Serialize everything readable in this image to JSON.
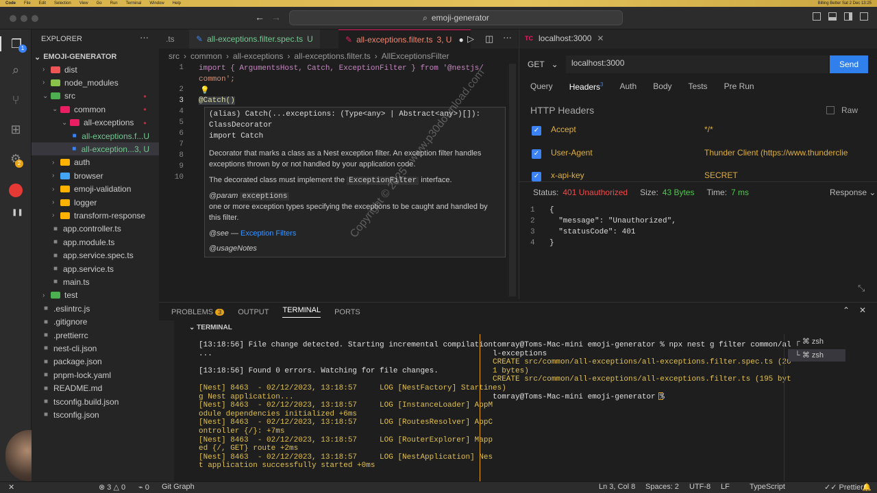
{
  "macbar": {
    "app": "Code",
    "menus": [
      "File",
      "Edit",
      "Selection",
      "View",
      "Go",
      "Run",
      "Terminal",
      "Window",
      "Help"
    ],
    "right": "Billing Better   Sat 2 Dec 13:25"
  },
  "window": {
    "search": "emoji-generator"
  },
  "sidebar": {
    "title": "EXPLORER",
    "project": "EMOJI-GENERATOR",
    "items": [
      {
        "label": "dist",
        "color": "#e55"
      },
      {
        "label": "node_modules",
        "color": "#8bc34a"
      },
      {
        "label": "src",
        "color": "#4caf50"
      },
      {
        "label": "common",
        "color": "#e91e63"
      },
      {
        "label": "all-exceptions",
        "color": "#e91e63"
      },
      {
        "label": "all-exceptions.f...",
        "badge": "U"
      },
      {
        "label": "all-exception...",
        "badge": "3, U"
      },
      {
        "label": "auth",
        "color": "#ffb300"
      },
      {
        "label": "browser",
        "color": "#42a5f5"
      },
      {
        "label": "emoji-validation",
        "color": "#ffb300"
      },
      {
        "label": "logger",
        "color": "#ffb300"
      },
      {
        "label": "transform-response",
        "color": "#ffb300"
      },
      {
        "label": "app.controller.ts"
      },
      {
        "label": "app.module.ts"
      },
      {
        "label": "app.service.spec.ts"
      },
      {
        "label": "app.service.ts"
      },
      {
        "label": "main.ts"
      },
      {
        "label": "test",
        "color": "#4caf50"
      },
      {
        "label": ".eslintrc.js"
      },
      {
        "label": ".gitignore"
      },
      {
        "label": ".prettierrc"
      },
      {
        "label": "nest-cli.json"
      },
      {
        "label": "package.json"
      },
      {
        "label": "pnpm-lock.yaml"
      },
      {
        "label": "README.md"
      },
      {
        "label": "tsconfig.build.json"
      },
      {
        "label": "tsconfig.json"
      }
    ]
  },
  "editor": {
    "tabs": [
      {
        "label": ".ts"
      },
      {
        "label": "all-exceptions.filter.spec.ts",
        "badge": "U"
      },
      {
        "label": "all-exceptions.filter.ts",
        "badge": "3, U"
      }
    ],
    "breadcrumb": [
      "src",
      "common",
      "all-exceptions",
      "all-exceptions.filter.ts",
      "AllExceptionsFilter"
    ],
    "lines": [
      "1",
      "2",
      "3",
      "4",
      "5",
      "6",
      "7",
      "8",
      "9",
      "10"
    ],
    "code1": "import { ArgumentsHost, Catch, ExceptionFilter } from '@nestjs/",
    "code1b": "common';",
    "code3": "@Catch()",
    "hover": {
      "sig": "(alias) Catch(...exceptions: (Type<any> | Abstract<any>)[]):",
      "sig2": "ClassDecorator",
      "sig3": "import Catch",
      "desc": "Decorator that marks a class as a Nest exception filter. An exception filter handles",
      "desc2": "exceptions thrown by or not handled by your application code.",
      "must": "The decorated class must implement the",
      "iface": "ExceptionFilter",
      "must2": "interface.",
      "param": "@param",
      "paramname": "exceptions",
      "paramdesc": "one or more exception types specifying the exceptions to be caught and handled by",
      "paramdesc2": "this filter.",
      "see": "@see —",
      "seelink": "Exception Filters",
      "usage": "@usageNotes"
    }
  },
  "thunder": {
    "tab": "localhost:3000",
    "method": "GET",
    "url": "localhost:3000",
    "send": "Send",
    "subtabs": [
      "Query",
      "Headers",
      "Auth",
      "Body",
      "Tests",
      "Pre Run"
    ],
    "headers_count": "3",
    "section": "HTTP Headers",
    "raw": "Raw",
    "headers": [
      {
        "k": "Accept",
        "v": "*/*"
      },
      {
        "k": "User-Agent",
        "v": "Thunder Client (https://www.thunderclie"
      },
      {
        "k": "x-api-key",
        "v": "SECRET"
      }
    ],
    "status_label": "Status:",
    "status": "401 Unauthorized",
    "size_label": "Size:",
    "size": "43 Bytes",
    "time_label": "Time:",
    "time": "7 ms",
    "response": "Response",
    "resp_lines": [
      "{",
      "  \"message\": \"Unauthorized\",",
      "  \"statusCode\": 401",
      "}"
    ],
    "resp_nums": [
      "1",
      "2",
      "3",
      "4"
    ]
  },
  "panel": {
    "tabs": [
      "PROBLEMS",
      "OUTPUT",
      "TERMINAL",
      "PORTS"
    ],
    "problems": "3",
    "terminal_title": "TERMINAL",
    "left": [
      "[13:18:56] File change detected. Starting incremental compilation",
      "...",
      "",
      "[13:18:56] Found 0 errors. Watching for file changes.",
      "",
      "[Nest] 8463  - 02/12/2023, 13:18:57     LOG [NestFactory] Startin",
      "g Nest application...",
      "[Nest] 8463  - 02/12/2023, 13:18:57     LOG [InstanceLoader] AppM",
      "odule dependencies initialized +6ms",
      "[Nest] 8463  - 02/12/2023, 13:18:57     LOG [RoutesResolver] AppC",
      "ontroller {/}: +7ms",
      "[Nest] 8463  - 02/12/2023, 13:18:57     LOG [RouterExplorer] Mapp",
      "ed {/, GET} route +2ms",
      "[Nest] 8463  - 02/12/2023, 13:18:57     LOG [NestApplication] Nes",
      "t application successfully started +0ms"
    ],
    "right": [
      "tomray@Toms-Mac-mini emoji-generator % npx nest g filter common/al",
      "l-exceptions",
      "CREATE src/common/all-exceptions/all-exceptions.filter.spec.ts (20",
      "1 bytes)",
      "CREATE src/common/all-exceptions/all-exceptions.filter.ts (195 byt",
      "es)",
      "tomray@Toms-Mac-mini emoji-generator % "
    ],
    "shells": [
      "zsh",
      "zsh"
    ]
  },
  "statusbar": {
    "errors": "3",
    "warnings": "0",
    "ports": "0",
    "git": "Git Graph",
    "pos": "Ln 3, Col 8",
    "spaces": "Spaces: 2",
    "enc": "UTF-8",
    "eol": "LF",
    "lang": "TypeScript",
    "prettier": "Prettier"
  },
  "watermark": "Copyright © 2025 - www.p30download.com"
}
